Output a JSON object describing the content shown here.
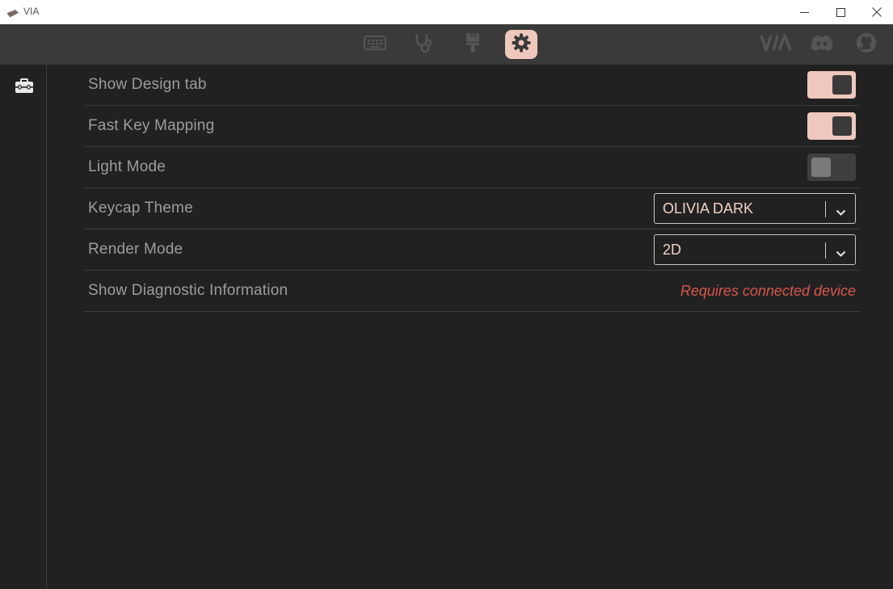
{
  "window": {
    "title": "VIA",
    "minimize_icon": "minimize-icon",
    "maximize_icon": "maximize-icon",
    "close_icon": "close-icon"
  },
  "topnav": {
    "tabs": [
      {
        "icon": "keyboard-icon",
        "active": false
      },
      {
        "icon": "stethoscope-icon",
        "active": false
      },
      {
        "icon": "paintbrush-icon",
        "active": false
      },
      {
        "icon": "gear-icon",
        "active": true
      }
    ],
    "external": [
      {
        "icon": "via-logo-icon"
      },
      {
        "icon": "discord-icon"
      },
      {
        "icon": "github-icon"
      }
    ],
    "accent": "#efc7bd"
  },
  "sidebar": {
    "items": [
      {
        "icon": "toolbox-icon"
      }
    ]
  },
  "settings": {
    "rows": [
      {
        "label": "Show Design tab",
        "control": "toggle",
        "on": true
      },
      {
        "label": "Fast Key Mapping",
        "control": "toggle",
        "on": true
      },
      {
        "label": "Light Mode",
        "control": "toggle",
        "on": false
      },
      {
        "label": "Keycap Theme",
        "control": "select",
        "value": "OLIVIA DARK"
      },
      {
        "label": "Render Mode",
        "control": "select",
        "value": "2D"
      },
      {
        "label": "Show Diagnostic Information",
        "control": "text",
        "value": "Requires connected device"
      }
    ]
  },
  "colors": {
    "background": "#212121",
    "nav": "#3a3a3a",
    "accent": "#efc7bd",
    "warning": "#d6574c"
  }
}
